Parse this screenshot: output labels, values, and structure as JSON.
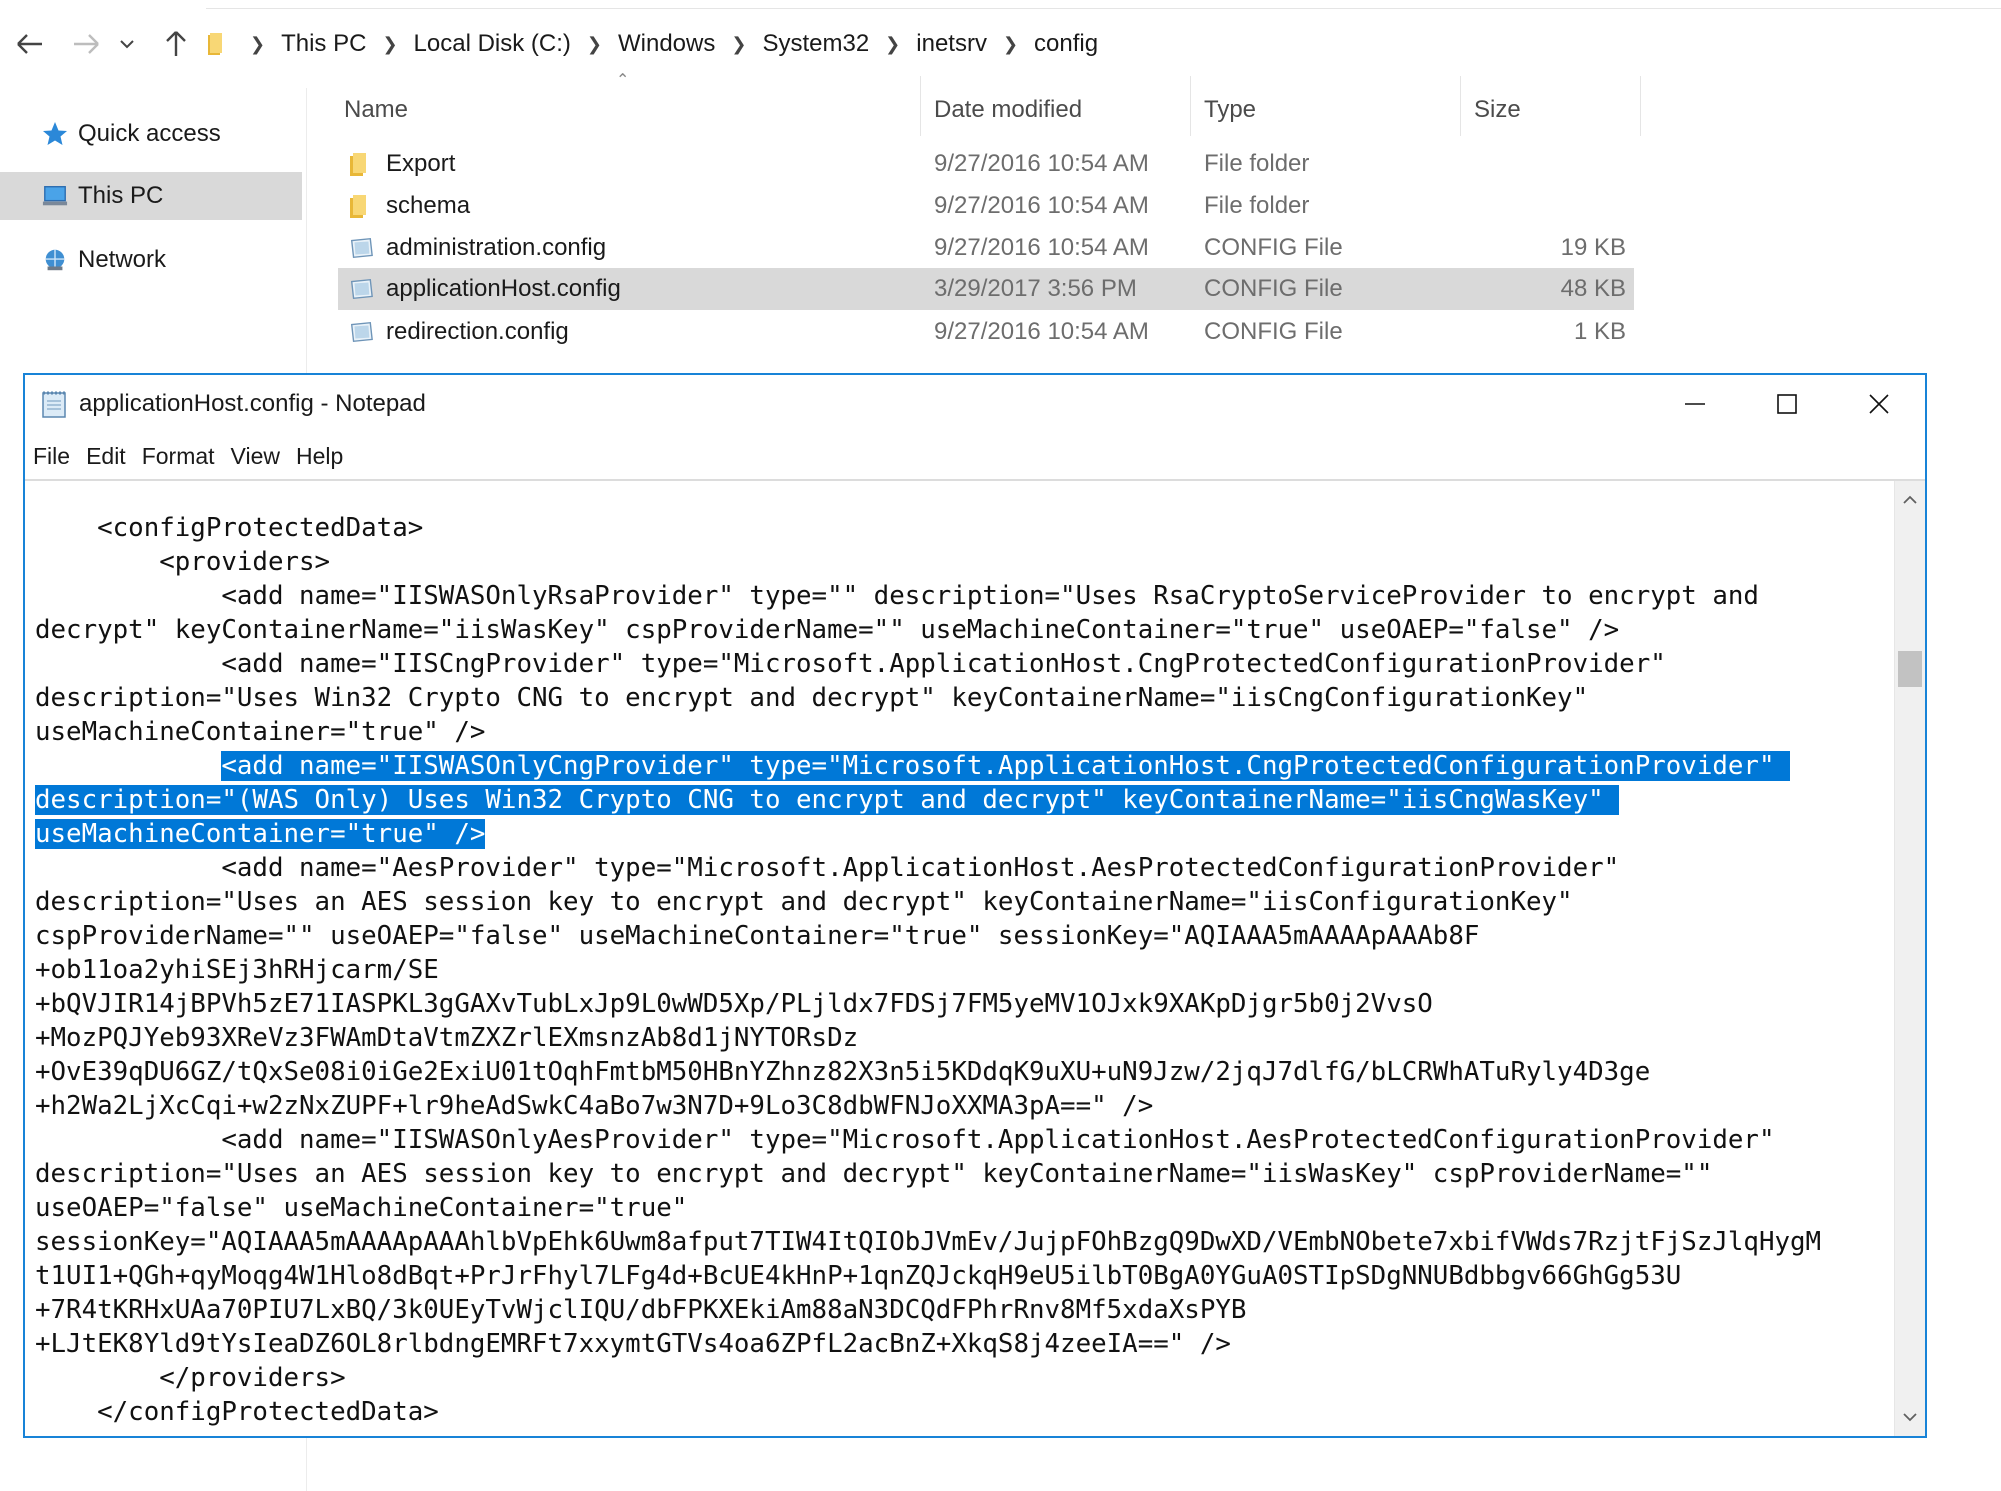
{
  "explorer": {
    "breadcrumbs": [
      "This PC",
      "Local Disk (C:)",
      "Windows",
      "System32",
      "inetsrv",
      "config"
    ],
    "nav": [
      {
        "label": "Quick access",
        "icon": "star-icon"
      },
      {
        "label": "This PC",
        "icon": "computer-icon",
        "selected": true
      },
      {
        "label": "Network",
        "icon": "network-icon"
      }
    ],
    "columns": {
      "name": "Name",
      "date": "Date modified",
      "type": "Type",
      "size": "Size"
    },
    "files": [
      {
        "name": "Export",
        "date": "9/27/2016 10:54 AM",
        "type": "File folder",
        "size": "",
        "icon": "folder-icon"
      },
      {
        "name": "schema",
        "date": "9/27/2016 10:54 AM",
        "type": "File folder",
        "size": "",
        "icon": "folder-icon"
      },
      {
        "name": "administration.config",
        "date": "9/27/2016 10:54 AM",
        "type": "CONFIG File",
        "size": "19 KB",
        "icon": "config-file-icon"
      },
      {
        "name": "applicationHost.config",
        "date": "3/29/2017 3:56 PM",
        "type": "CONFIG File",
        "size": "48 KB",
        "icon": "config-file-icon",
        "selected": true
      },
      {
        "name": "redirection.config",
        "date": "9/27/2016 10:54 AM",
        "type": "CONFIG File",
        "size": "1 KB",
        "icon": "config-file-icon"
      }
    ]
  },
  "notepad": {
    "title": "applicationHost.config - Notepad",
    "menu": [
      "File",
      "Edit",
      "Format",
      "View",
      "Help"
    ],
    "lines_before": [
      "    <configProtectedData>",
      "        <providers>",
      "            <add name=\"IISWASOnlyRsaProvider\" type=\"\" description=\"Uses RsaCryptoServiceProvider to encrypt and",
      "decrypt\" keyContainerName=\"iisWasKey\" cspProviderName=\"\" useMachineContainer=\"true\" useOAEP=\"false\" />",
      "            <add name=\"IISCngProvider\" type=\"Microsoft.ApplicationHost.CngProtectedConfigurationProvider\"",
      "description=\"Uses Win32 Crypto CNG to encrypt and decrypt\" keyContainerName=\"iisCngConfigurationKey\"",
      "useMachineContainer=\"true\" />"
    ],
    "selected_indent": "            ",
    "selected_lines": [
      "<add name=\"IISWASOnlyCngProvider\" type=\"Microsoft.ApplicationHost.CngProtectedConfigurationProvider\" ",
      "description=\"(WAS Only) Uses Win32 Crypto CNG to encrypt and decrypt\" keyContainerName=\"iisCngWasKey\" ",
      "useMachineContainer=\"true\" />"
    ],
    "lines_after": [
      "            <add name=\"AesProvider\" type=\"Microsoft.ApplicationHost.AesProtectedConfigurationProvider\"",
      "description=\"Uses an AES session key to encrypt and decrypt\" keyContainerName=\"iisConfigurationKey\"",
      "cspProviderName=\"\" useOAEP=\"false\" useMachineContainer=\"true\" sessionKey=\"AQIAAA5mAAAApAAAb8F",
      "+ob11oa2yhiSEj3hRHjcarm/SE",
      "+bQVJIR14jBPVh5zE71IASPKL3gGAXvTubLxJp9L0wWD5Xp/PLjldx7FDSj7FM5yeMV1OJxk9XAKpDjgr5b0j2VvsO",
      "+MozPQJYeb93XReVz3FWAmDtaVtmZXZrlEXmsnzAb8d1jNYTORsDz",
      "+OvE39qDU6GZ/tQxSe08i0iGe2ExiU01tOqhFmtbM50HBnYZhnz82X3n5i5KDdqK9uXU+uN9Jzw/2jqJ7dlfG/bLCRWhATuRyly4D3ge",
      "+h2Wa2LjXcCqi+w2zNxZUPF+lr9heAdSwkC4aBo7w3N7D+9Lo3C8dbWFNJoXXMA3pA==\" />",
      "            <add name=\"IISWASOnlyAesProvider\" type=\"Microsoft.ApplicationHost.AesProtectedConfigurationProvider\"",
      "description=\"Uses an AES session key to encrypt and decrypt\" keyContainerName=\"iisWasKey\" cspProviderName=\"\"",
      "useOAEP=\"false\" useMachineContainer=\"true\"",
      "sessionKey=\"AQIAAA5mAAAApAAAhlbVpEhk6Uwm8afput7TIW4ItQIObJVmEv/JujpFOhBzgQ9DwXD/VEmbNObete7xbifVWds7RzjtFjSzJlqHygM",
      "t1UI1+QGh+qyMoqg4W1Hlo8dBqt+PrJrFhyl7LFg4d+BcUE4kHnP+1qnZQJckqH9eU5ilbT0BgA0YGuA0STIpSDgNNUBdbbgv66GhGg53U",
      "+7R4tKRHxUAa70PIU7LxBQ/3k0UEyTvWjclIQU/dbFPKXEkiAm88aN3DCQdFPhrRnv8Mf5xdaXsPYB",
      "+LJtEK8Yld9tYsIeaDZ6OL8rlbdngEMRFt7xxymtGTVs4oa6ZPfL2acBnZ+XkqS8j4zeeIA==\" />",
      "        </providers>",
      "    </configProtectedData>"
    ]
  }
}
